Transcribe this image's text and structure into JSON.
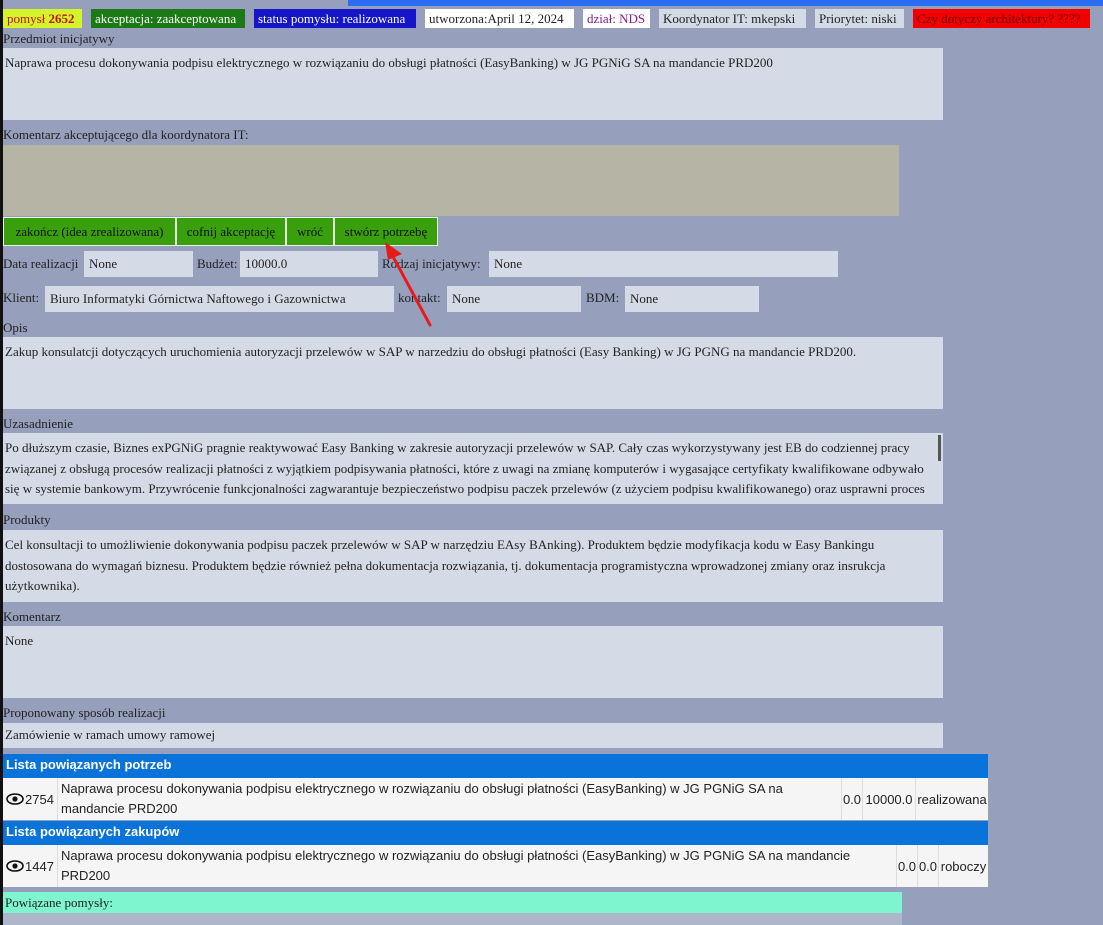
{
  "badges": {
    "idea_label": "pomysł",
    "idea_number": "2652",
    "acceptance": "akceptacja: zaakceptowana",
    "status": "status pomysłu: realizowana",
    "created": "utworzona:April 12, 2024",
    "department": "dział: NDS",
    "coordinator": "Koordynator IT: mkepski",
    "priority": "Priorytet: niski",
    "architecture": "Czy dotyczy architektury? ????"
  },
  "subject": {
    "label": "Przedmiot inicjatywy",
    "value": "Naprawa procesu dokonywania podpisu elektrycznego w rozwiązaniu do obsługi płatności (EasyBanking) w JG PGNiG SA na mandancie PRD200"
  },
  "comment_for_coordinator": {
    "label": "Komentarz akceptującego dla koordynatora IT:",
    "value": ""
  },
  "actions": {
    "finish": "zakończ (idea zrealizowana)",
    "revoke": "cofnij akceptację",
    "back": "wróć",
    "create_need": "stwórz potrzebę"
  },
  "fields": {
    "realization_date_label": "Data realizacji",
    "realization_date": "None",
    "budget_label": "Budżet:",
    "budget": "10000.0",
    "initiative_type_label": "Rodzaj inicjatywy:",
    "initiative_type": "None",
    "client_label": "Klient:",
    "client": "Biuro Informatyki Górnictwa Naftowego i Gazownictwa",
    "contact_label": "kontakt:",
    "contact": "None",
    "bdm_label": "BDM:",
    "bdm": "None"
  },
  "description": {
    "label": "Opis",
    "value": "Zakup konsulatcji dotyczących uruchomienia autoryzacji przelewów w SAP w narzedziu do obsługi płatności (Easy Banking) w JG PGNG na mandancie PRD200."
  },
  "justification": {
    "label": "Uzasadnienie",
    "value": "Po dłuższym czasie, Biznes exPGNiG pragnie reaktywować Easy Banking w zakresie autoryzacji przelewów w SAP. Cały czas wykorzystywany jest  EB do codziennej pracy związanej z obsługą procesów realizacji płatności z wyjątkiem podpisywania płatności, które z uwagi na zmianę komputerów i wygasające certyfikaty kwalifikowane odbywało się w systemie bankowym. Przywrócenie funkcjonalności zagwarantuje bezpieczeństwo podpisu  paczek przelewów (z użyciem podpisu kwalifikowanego) oraz usprawni proces realizacji płatności."
  },
  "products": {
    "label": "Produkty",
    "value": " Cel konsultacji to umożliwienie dokonywania podpisu paczek przelewów w SAP w narzędziu EAsy BAnking). Produktem będzie modyfikacja kodu w Easy Bankingu dostosowana  do wymagań biznesu. Produktem będzie również pełna dokumentacja rozwiązania, tj. dokumentacja programistyczna wprowadzonej zmiany oraz insrukcja użytkownika)."
  },
  "comment": {
    "label": "Komentarz",
    "value": "None"
  },
  "proposed": {
    "label": "Proponowany sposób realizacji",
    "value": " Zamówienie w ramach umowy ramowej"
  },
  "needs": {
    "header": "Lista powiązanych potrzeb",
    "rows": [
      {
        "id": "2754",
        "title": "Naprawa procesu dokonywania podpisu elektrycznego w rozwiązaniu do obsługi płatności (EasyBanking) w JG PGNiG SA na mandancie PRD200",
        "v1": "0.0",
        "v2": "10000.0",
        "status": "realizowana"
      }
    ]
  },
  "purchases": {
    "header": "Lista powiązanych zakupów",
    "rows": [
      {
        "id": "1447",
        "title": "Naprawa procesu dokonywania podpisu elektrycznego w rozwiązaniu do obsługi płatności (EasyBanking) w JG PGNiG SA na mandancie PRD200",
        "v1": "0.0",
        "v2": "0.0",
        "status": "roboczy"
      }
    ]
  },
  "related": {
    "label": "Powiązane pomysły:"
  },
  "colors": {
    "page_bg": "#96a0bd",
    "field_bg": "#d5dae7",
    "button_green": "#3a9f0c",
    "header_blue": "#0a73d9",
    "annotation_red": "#e81b1b",
    "related_bg": "#7ff5cf"
  },
  "icons": {
    "view": "eye-icon"
  }
}
